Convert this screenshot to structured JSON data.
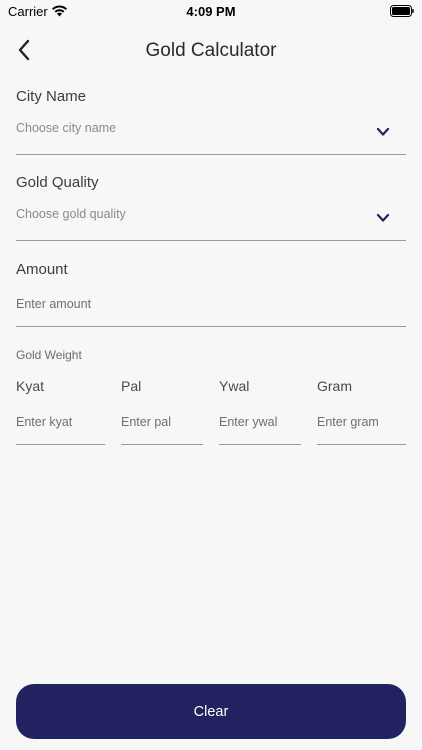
{
  "status_bar": {
    "carrier": "Carrier",
    "time": "4:09 PM"
  },
  "nav": {
    "title": "Gold Calculator"
  },
  "city": {
    "label": "City Name",
    "placeholder": "Choose city name"
  },
  "quality": {
    "label": "Gold Quality",
    "placeholder": "Choose gold quality"
  },
  "amount": {
    "label": "Amount",
    "placeholder": "Enter amount"
  },
  "weight": {
    "section_label": "Gold Weight",
    "fields": [
      {
        "label": "Kyat",
        "placeholder": "Enter kyat"
      },
      {
        "label": "Pal",
        "placeholder": "Enter pal"
      },
      {
        "label": "Ywal",
        "placeholder": "Enter ywal"
      },
      {
        "label": "Gram",
        "placeholder": "Enter gram"
      }
    ]
  },
  "actions": {
    "clear_label": "Clear"
  },
  "colors": {
    "accent": "#232260",
    "background": "#f7f7f7"
  }
}
